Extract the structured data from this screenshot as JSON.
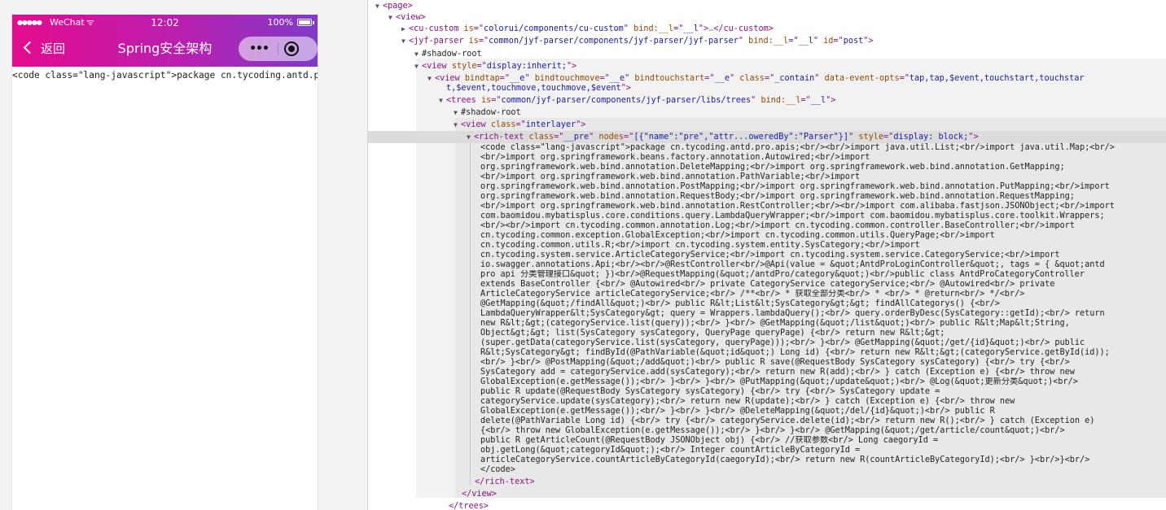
{
  "phone": {
    "status": {
      "signal": "●●●●●",
      "carrier": "WeChat",
      "wifi": "ᯤ",
      "time": "12:02",
      "battery_pct": "100%",
      "battery_level": 1.0
    },
    "nav": {
      "back_label": "返回",
      "title": "Spring安全架构",
      "more_glyph": "•••"
    },
    "content_line": "<code class=\"lang-javascript\">package cn.tycoding.antd.pro.apis;"
  },
  "devtools": {
    "rows": [
      {
        "tri": "▼",
        "html": "<page>",
        "segs": [
          [
            "tag",
            "<page>"
          ]
        ]
      },
      {
        "tri": "▼",
        "segs": [
          [
            "tag",
            "<view>"
          ]
        ]
      },
      {
        "tri": "▶",
        "segs": [
          [
            "tag",
            "<cu-custom "
          ],
          [
            "an",
            "is"
          ],
          [
            "tag",
            "=\""
          ],
          [
            "av",
            "colorui/components/cu-custom"
          ],
          [
            "tag",
            "\" "
          ],
          [
            "an",
            "bind:__l"
          ],
          [
            "tag",
            "=\""
          ],
          [
            "av",
            "__l"
          ],
          [
            "tag",
            "\">"
          ],
          [
            "dim",
            "…"
          ],
          [
            "tag",
            "</cu-custom>"
          ]
        ]
      },
      {
        "tri": "▼",
        "segs": [
          [
            "tag",
            "<jyf-parser "
          ],
          [
            "an",
            "is"
          ],
          [
            "tag",
            "=\""
          ],
          [
            "av",
            "common/jyf-parser/components/jyf-parser/jyf-parser"
          ],
          [
            "tag",
            "\" "
          ],
          [
            "an",
            "bind:__l"
          ],
          [
            "tag",
            "=\""
          ],
          [
            "av",
            "__l"
          ],
          [
            "tag",
            "\" "
          ],
          [
            "an",
            "id"
          ],
          [
            "tag",
            "=\""
          ],
          [
            "av",
            "post"
          ],
          [
            "tag",
            "\">"
          ]
        ]
      },
      {
        "tri": "▼",
        "segs": [
          [
            "txt",
            "#shadow-root"
          ]
        ]
      },
      {
        "tri": "▼",
        "segs": [
          [
            "tag",
            "<view "
          ],
          [
            "an",
            "style"
          ],
          [
            "tag",
            "=\""
          ],
          [
            "av",
            "display:inherit;"
          ],
          [
            "tag",
            "\">"
          ]
        ]
      },
      {
        "tri": "▼",
        "segs": [
          [
            "tag",
            "<view "
          ],
          [
            "an",
            "bindtap"
          ],
          [
            "tag",
            "=\""
          ],
          [
            "av",
            "__e"
          ],
          [
            "tag",
            "\" "
          ],
          [
            "an",
            "bindtouchmove"
          ],
          [
            "tag",
            "=\""
          ],
          [
            "av",
            "__e"
          ],
          [
            "tag",
            "\" "
          ],
          [
            "an",
            "bindtouchstart"
          ],
          [
            "tag",
            "=\""
          ],
          [
            "av",
            "__e"
          ],
          [
            "tag",
            "\" "
          ],
          [
            "an",
            "class"
          ],
          [
            "tag",
            "=\""
          ],
          [
            "av",
            "_contain"
          ],
          [
            "tag",
            "\" "
          ],
          [
            "an",
            "data-event-opts"
          ],
          [
            "tag",
            "=\""
          ],
          [
            "av",
            "tap,tap,$event,touchstart,touchstar"
          ]
        ]
      },
      {
        "tri": "",
        "segs": [
          [
            "av",
            "t,$event,touchmove,touchmove,$event"
          ],
          [
            "tag",
            "\">"
          ]
        ]
      },
      {
        "tri": "▼",
        "segs": [
          [
            "tag",
            "<trees "
          ],
          [
            "an",
            "is"
          ],
          [
            "tag",
            "=\""
          ],
          [
            "av",
            "common/jyf-parser/components/jyf-parser/libs/trees"
          ],
          [
            "tag",
            "\" "
          ],
          [
            "an",
            "bind:__l"
          ],
          [
            "tag",
            "=\""
          ],
          [
            "av",
            "__l"
          ],
          [
            "tag",
            "\">"
          ]
        ]
      },
      {
        "tri": "▼",
        "segs": [
          [
            "txt",
            "#shadow-root"
          ]
        ]
      },
      {
        "tri": "▼",
        "segs": [
          [
            "tag",
            "<view "
          ],
          [
            "an",
            "class"
          ],
          [
            "tag",
            "=\""
          ],
          [
            "av",
            "interlayer"
          ],
          [
            "tag",
            "\">"
          ]
        ]
      },
      {
        "tri": "▼",
        "segs": [
          [
            "tag",
            "<rich-text "
          ],
          [
            "an",
            "class"
          ],
          [
            "tag",
            "=\""
          ],
          [
            "av",
            "__pre"
          ],
          [
            "tag",
            "\" "
          ],
          [
            "an",
            "nodes"
          ],
          [
            "tag",
            "=\""
          ],
          [
            "av",
            "[{\"name\":\"pre\",\"attr...oweredBy\":\"Parser\"}]"
          ],
          [
            "tag",
            "\" "
          ],
          [
            "an",
            "style"
          ],
          [
            "tag",
            "=\""
          ],
          [
            "av",
            "display: block;"
          ],
          [
            "tag",
            "\">"
          ]
        ]
      }
    ],
    "code_lines": [
      "<code class=\"lang-javascript\">package cn.tycoding.antd.pro.apis;<br/><br/>import java.util.List;<br/>import java.util.Map;<br/>",
      "<br/>import org.springframework.beans.factory.annotation.Autowired;<br/>import",
      "org.springframework.web.bind.annotation.DeleteMapping;<br/>import org.springframework.web.bind.annotation.GetMapping;",
      "<br/>import org.springframework.web.bind.annotation.PathVariable;<br/>import",
      "org.springframework.web.bind.annotation.PostMapping;<br/>import org.springframework.web.bind.annotation.PutMapping;<br/>import",
      "org.springframework.web.bind.annotation.RequestBody;<br/>import org.springframework.web.bind.annotation.RequestMapping;",
      "<br/>import org.springframework.web.bind.annotation.RestController;<br/><br/>import com.alibaba.fastjson.JSONObject;<br/>import",
      "com.baomidou.mybatisplus.core.conditions.query.LambdaQueryWrapper;<br/>import com.baomidou.mybatisplus.core.toolkit.Wrappers;",
      "<br/><br/>import cn.tycoding.common.annotation.Log;<br/>import cn.tycoding.common.controller.BaseController;<br/>import",
      "cn.tycoding.common.exception.GlobalException;<br/>import cn.tycoding.common.utils.QueryPage;<br/>import",
      "cn.tycoding.common.utils.R;<br/>import cn.tycoding.system.entity.SysCategory;<br/>import",
      "cn.tycoding.system.service.ArticleCategoryService;<br/>import cn.tycoding.system.service.CategoryService;<br/>import",
      "io.swagger.annotations.Api;<br/><br/>@RestController<br/>@Api(value = &quot;AntdProLoginController&quot;, tags = { &quot;antd",
      "pro api 分类管理接口&quot; })<br/>@RequestMapping(&quot;/antdPro/category&quot;)<br/>public class AntdProCategoryController",
      "extends BaseController {<br/> @Autowired<br/> private CategoryService categoryService;<br/> @Autowired<br/> private",
      "ArticleCategoryService articleCategoryService;<br/> /**<br/> * 获取全部分类<br/> * <br/> * @return<br/> */<br/>",
      "@GetMapping(&quot;/findAll&quot;)<br/> public R&lt;List&lt;SysCategory&gt;&gt; findAllCategorys() {<br/>",
      "LambdaQueryWrapper&lt;SysCategory&gt; query = Wrappers.lambdaQuery();<br/> query.orderByDesc(SysCategory::getId);<br/> return",
      "new R&lt;&gt;(categoryService.list(query));<br/> }<br/> @GetMapping(&quot;/list&quot;)<br/> public R&lt;Map&lt;String,",
      "Object&gt;&gt; list(SysCategory sysCategory, QueryPage queryPage) {<br/> return new R&lt;&gt;",
      "(super.getData(categoryService.list(sysCategory, queryPage)));<br/> }<br/> @GetMapping(&quot;/get/{id}&quot;)<br/> public",
      "R&lt;SysCategory&gt; findById(@PathVariable(&quot;id&quot;) Long id) {<br/> return new R&lt;&gt;(categoryService.getById(id));",
      "<br/> }<br/> @PostMapping(&quot;/add&quot;)<br/> public R save(@RequestBody SysCategory sysCategory) {<br/> try {<br/>",
      "SysCategory add = categoryService.add(sysCategory);<br/> return new R(add);<br/> } catch (Exception e) {<br/> throw new",
      "GlobalException(e.getMessage());<br/> }<br/> }<br/> @PutMapping(&quot;/update&quot;)<br/> @Log(&quot;更新分类&quot;)<br/>",
      "public R update(@RequestBody SysCategory sysCategory) {<br/> try {<br/> SysCategory update =",
      "categoryService.update(sysCategory);<br/> return new R(update);<br/> } catch (Exception e) {<br/> throw new",
      "GlobalException(e.getMessage());<br/> }<br/> }<br/> @DeleteMapping(&quot;/del/{id}&quot;)<br/> public R",
      "delete(@PathVariable Long id) {<br/> try {<br/> categoryService.delete(id);<br/> return new R();<br/> } catch (Exception e)",
      "{<br/> throw new GlobalException(e.getMessage());<br/> }<br/> }<br/> @GetMapping(&quot;/get/article/count&quot;)<br/>",
      "public R getArticleCount(@RequestBody JSONObject obj) {<br/> //获取参数<br/> Long caegoryId =",
      "obj.getLong(&quot;categoryId&quot;);<br/> Integer countArticleByCategoryId =",
      "articleCategoryService.countArticleByCategoryId(caegoryId);<br/> return new R(countArticleByCategoryId);<br/> }<br/>}<br/>",
      "</code>"
    ],
    "closing": [
      {
        "segs": [
          [
            "tag",
            "</rich-text>"
          ]
        ]
      },
      {
        "segs": [
          [
            "tag",
            "</view>"
          ]
        ]
      },
      {
        "segs": [
          [
            "tag",
            "</trees>"
          ]
        ]
      }
    ]
  }
}
